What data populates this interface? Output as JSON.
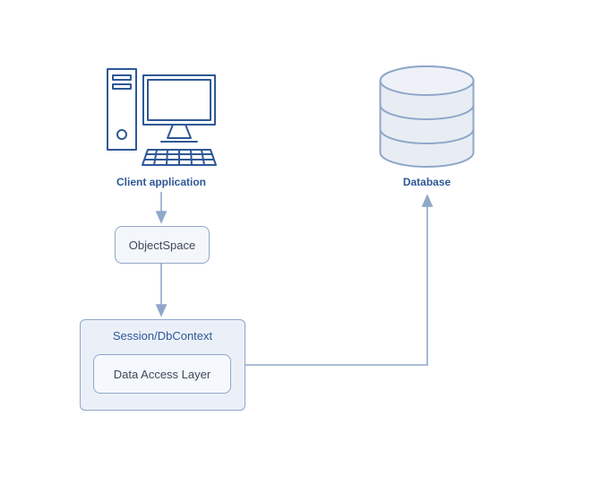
{
  "nodes": {
    "client": {
      "label": "Client application"
    },
    "objectspace": {
      "label": "ObjectSpace"
    },
    "session": {
      "title": "Session/DbContext",
      "inner": "Data Access Layer"
    },
    "database": {
      "label": "Database"
    }
  },
  "colors": {
    "stroke": "#8fa7c9",
    "text": "#2f5896",
    "fillLight": "#f3f6fb",
    "fillMed": "#ebf0f8",
    "dbFill": "#e8edf4"
  }
}
